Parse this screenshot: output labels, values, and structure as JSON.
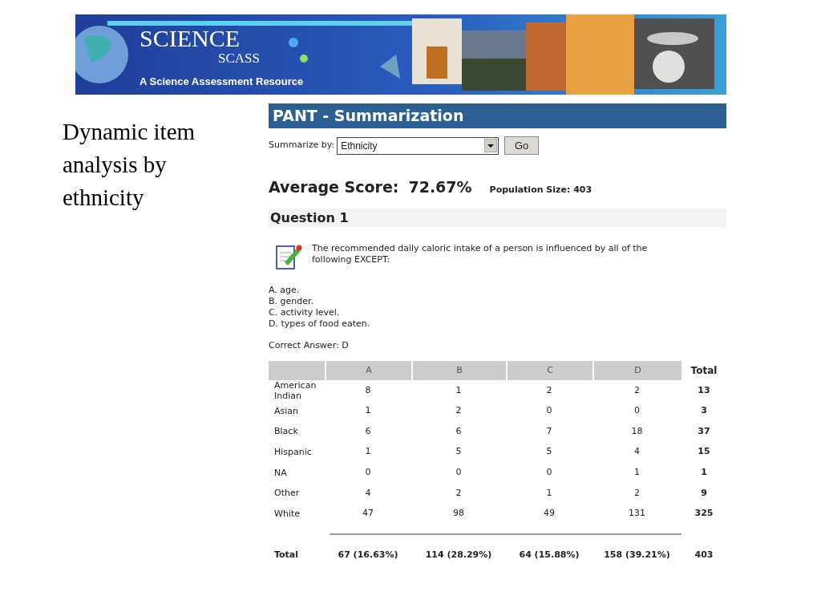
{
  "slide_caption": "Dynamic item analysis by ethnicity",
  "banner": {
    "title": "SCIENCE",
    "subtitle": "SCASS",
    "tagline": "A Science Assessment Resource"
  },
  "page_title": "PANT - Summarization",
  "summarize": {
    "label": "Summarize by:",
    "value": "Ethnicity",
    "button": "Go"
  },
  "average": {
    "label": "Average Score:",
    "value": "72.67%",
    "population": "Population Size: 403"
  },
  "question": {
    "heading": "Question 1",
    "text": "The recommended daily caloric intake of a person is influenced by all of the following EXCEPT:",
    "choices": [
      "A. age.",
      "B. gender.",
      "C. activity level.",
      "D. types of food eaten."
    ],
    "correct": "Correct Answer: D"
  },
  "table": {
    "columns": [
      "A",
      "B",
      "C",
      "D",
      "Total"
    ],
    "rows": [
      {
        "label": "American Indian",
        "cells": [
          "8",
          "1",
          "2",
          "2",
          "13"
        ]
      },
      {
        "label": "Asian",
        "cells": [
          "1",
          "2",
          "0",
          "0",
          "3"
        ]
      },
      {
        "label": "Black",
        "cells": [
          "6",
          "6",
          "7",
          "18",
          "37"
        ]
      },
      {
        "label": "Hispanic",
        "cells": [
          "1",
          "5",
          "5",
          "4",
          "15"
        ]
      },
      {
        "label": "NA",
        "cells": [
          "0",
          "0",
          "0",
          "1",
          "1"
        ]
      },
      {
        "label": "Other",
        "cells": [
          "4",
          "2",
          "1",
          "2",
          "9"
        ]
      },
      {
        "label": "White",
        "cells": [
          "47",
          "98",
          "49",
          "131",
          "325"
        ]
      }
    ],
    "total": {
      "label": "Total",
      "cells": [
        "67 (16.63%)",
        "114 (28.29%)",
        "64 (15.88%)",
        "158 (39.21%)",
        "403"
      ]
    }
  }
}
